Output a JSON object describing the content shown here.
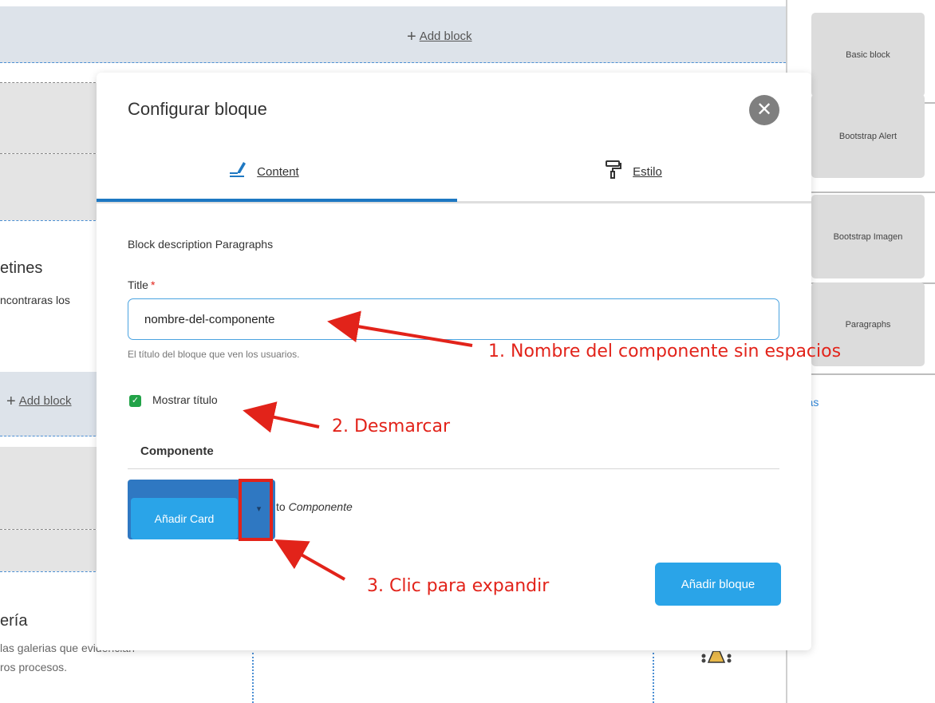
{
  "background": {
    "add_block_label": "Add block",
    "left_heading_1": "etines",
    "left_text_1": "ncontraras los",
    "left_heading_2": "ería",
    "left_text_2a": "las galerias que evidencian",
    "left_text_2b": "ros procesos."
  },
  "sidebar": {
    "items": [
      {
        "label": "Basic block"
      },
      {
        "label": "Bootstrap Alert"
      },
      {
        "label": "Bootstrap Imagen"
      },
      {
        "label": "Paragraphs"
      }
    ],
    "back_label": "trás"
  },
  "modal": {
    "title": "Configurar bloque",
    "close_glyph": "✕",
    "tabs": [
      {
        "label": "Content",
        "active": true
      },
      {
        "label": "Estilo",
        "active": false
      }
    ],
    "block_description": "Block description Paragraphs",
    "title_field": {
      "label": "Title",
      "required_mark": "*",
      "value": "nombre-del-componente",
      "help": "El título del bloque que ven los usuarios."
    },
    "show_title": {
      "label": "Mostrar título",
      "checked": true
    },
    "component_section": {
      "heading": "Componente",
      "add_card_label": "Añadir Card",
      "toggle_glyph": "▾",
      "to_prefix": "to",
      "to_target": "Componente"
    },
    "submit_label": "Añadir bloque"
  },
  "annotations": [
    {
      "text": "1. Nombre del componente sin espacios"
    },
    {
      "text": "2. Desmarcar"
    },
    {
      "text": "3. Clic para expandir"
    }
  ],
  "colors": {
    "accent": "#2aa4e8",
    "tab_active": "#1e78c2",
    "annotation": "#e2231a",
    "checkbox": "#22a348"
  }
}
